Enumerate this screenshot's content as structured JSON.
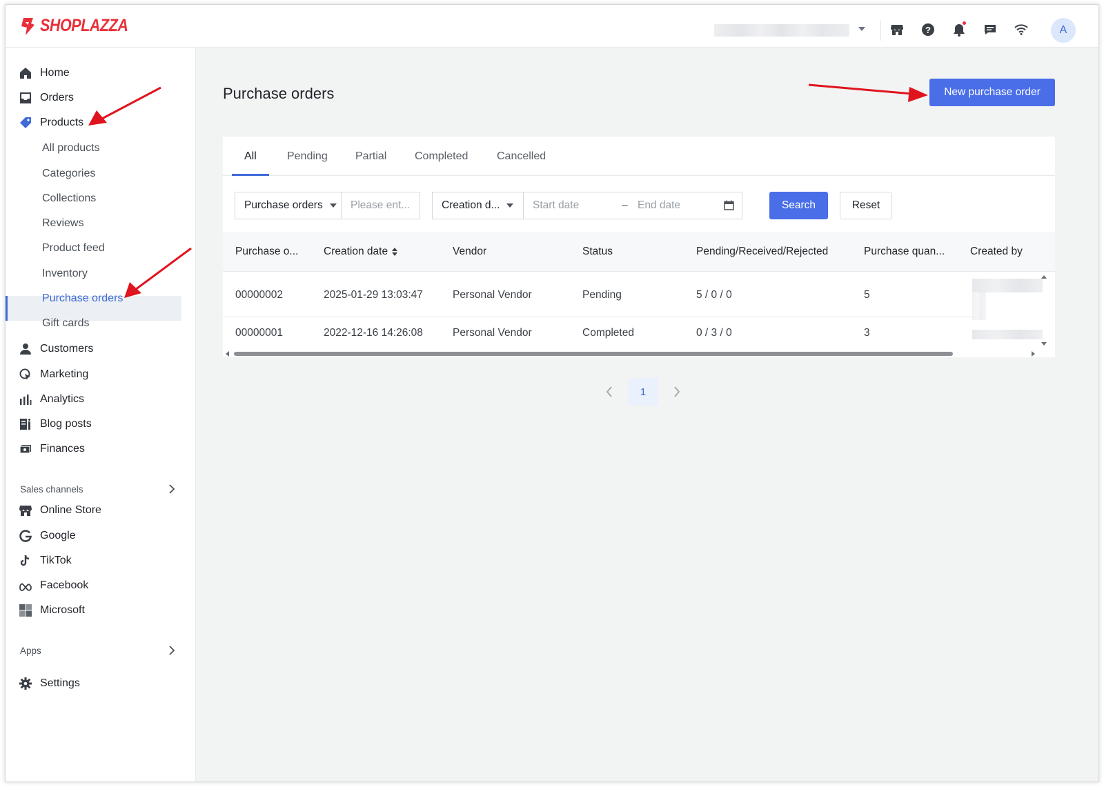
{
  "app": {
    "logo_text": "SHOPLAZZA",
    "avatar_initial": "A"
  },
  "topbar": {
    "icons": [
      "store-icon",
      "help-icon",
      "bell-icon",
      "chat-icon",
      "wifi-icon"
    ]
  },
  "sidebar": {
    "items": [
      {
        "label": "Home",
        "icon": "home-icon"
      },
      {
        "label": "Orders",
        "icon": "inbox-icon"
      },
      {
        "label": "Products",
        "icon": "tag-icon"
      }
    ],
    "products_sub": [
      "All products",
      "Categories",
      "Collections",
      "Reviews",
      "Product feed",
      "Inventory",
      "Purchase orders",
      "Gift cards"
    ],
    "items2": [
      {
        "label": "Customers",
        "icon": "person-icon"
      },
      {
        "label": "Marketing",
        "icon": "marketing-icon"
      },
      {
        "label": "Analytics",
        "icon": "bar-chart-icon"
      },
      {
        "label": "Blog posts",
        "icon": "blog-icon"
      },
      {
        "label": "Finances",
        "icon": "finance-icon"
      }
    ],
    "sales_channels_label": "Sales channels",
    "channels": [
      {
        "label": "Online Store",
        "icon": "store-icon"
      },
      {
        "label": "Google",
        "icon": "google-icon"
      },
      {
        "label": "TikTok",
        "icon": "tiktok-icon"
      },
      {
        "label": "Facebook",
        "icon": "meta-icon"
      },
      {
        "label": "Microsoft",
        "icon": "microsoft-icon"
      }
    ],
    "apps_label": "Apps",
    "settings_label": "Settings"
  },
  "page": {
    "title": "Purchase orders",
    "new_button": "New purchase order"
  },
  "tabs": [
    "All",
    "Pending",
    "Partial",
    "Completed",
    "Cancelled"
  ],
  "filters": {
    "field_select": "Purchase orders",
    "field_placeholder": "Please ent...",
    "date_select": "Creation d...",
    "start_placeholder": "Start date",
    "date_separator": "–",
    "end_placeholder": "End date",
    "search": "Search",
    "reset": "Reset"
  },
  "table": {
    "columns": [
      "Purchase o...",
      "Creation date",
      "Vendor",
      "Status",
      "Pending/Received/Rejected",
      "Purchase quan...",
      "Created by"
    ],
    "rows": [
      {
        "id": "00000002",
        "date": "2025-01-29 13:03:47",
        "vendor": "Personal Vendor",
        "status": "Pending",
        "prr": "5 / 0 / 0",
        "qty": "5"
      },
      {
        "id": "00000001",
        "date": "2022-12-16 14:26:08",
        "vendor": "Personal Vendor",
        "status": "Completed",
        "prr": "0 / 3 / 0",
        "qty": "3"
      }
    ]
  },
  "pagination": {
    "current": "1"
  },
  "colors": {
    "accent": "#4a6ee8",
    "brand": "#e9303a",
    "arrow": "#e0141e"
  }
}
